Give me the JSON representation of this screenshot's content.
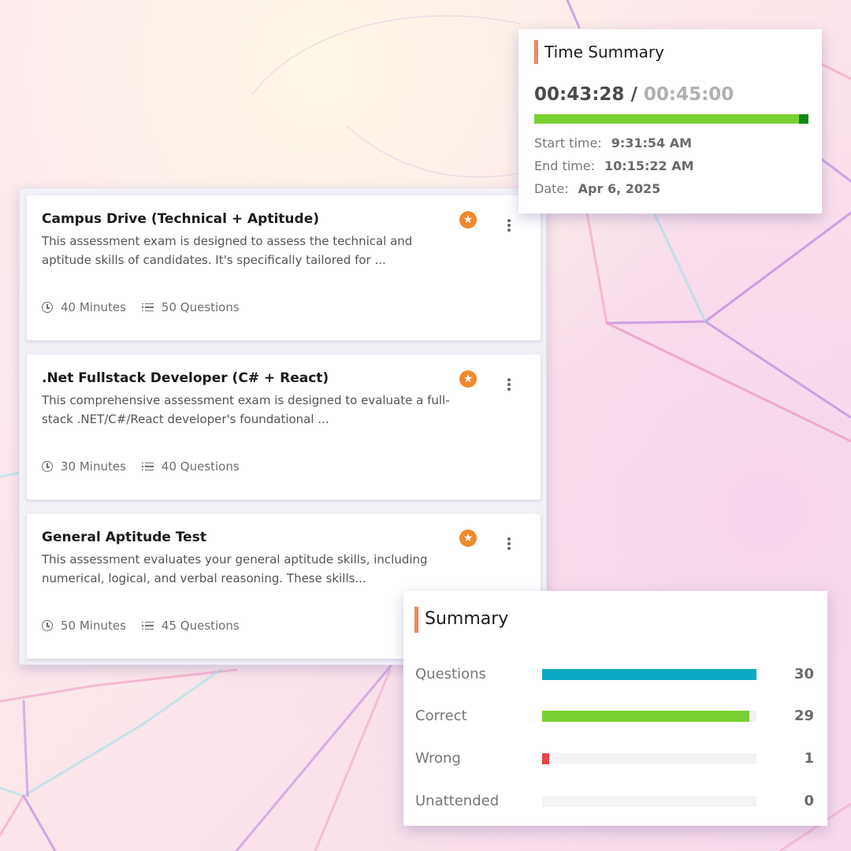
{
  "colors": {
    "accent": "#f0855d",
    "star": "#f0882d",
    "progress_fill": "#77d132",
    "progress_end": "#0e8a16",
    "questions_bar": "#0aa8c2",
    "correct_bar": "#77d132",
    "wrong_bar": "#e8434a",
    "track": "#f4f4f6"
  },
  "exams": [
    {
      "title": "Campus Drive (Technical + Aptitude)",
      "desc_line1": "This assessment exam is designed to assess the technical and",
      "desc_line2": "aptitude skills of candidates. It's specifically tailored for ...",
      "duration": "40 Minutes",
      "questions": "50 Questions",
      "star_icon": "star-icon",
      "menu_icon": "more-vertical-icon"
    },
    {
      "title": ".Net Fullstack Developer (C# + React)",
      "desc_line1": "This comprehensive assessment exam is designed to evaluate a full-",
      "desc_line2": "stack .NET/C#/React developer's foundational ...",
      "duration": "30 Minutes",
      "questions": "40 Questions",
      "star_icon": "star-icon",
      "menu_icon": "more-vertical-icon"
    },
    {
      "title": "General Aptitude Test",
      "desc_line1": "This assessment evaluates your general aptitude skills, including",
      "desc_line2": "numerical, logical, and verbal reasoning. These skills...",
      "duration": "50 Minutes",
      "questions": "45 Questions",
      "star_icon": "star-icon",
      "menu_icon": "more-vertical-icon"
    }
  ],
  "time_summary": {
    "title": "Time Summary",
    "elapsed": "00:43:28",
    "separator": "/",
    "total": "00:45:00",
    "progress_fraction": 0.966,
    "start_label": "Start time:",
    "start_value": "9:31:54 AM",
    "end_label": "End time:",
    "end_value": "10:15:22 AM",
    "date_label": "Date:",
    "date_value": "Apr 6, 2025"
  },
  "summary": {
    "title": "Summary",
    "total": 30,
    "rows": [
      {
        "label": "Questions",
        "count": "30",
        "value": 30,
        "color": "#0aa8c2"
      },
      {
        "label": "Correct",
        "count": "29",
        "value": 29,
        "color": "#77d132"
      },
      {
        "label": "Wrong",
        "count": "1",
        "value": 1,
        "color": "#e8434a"
      },
      {
        "label": "Unattended",
        "count": "0",
        "value": 0,
        "color": "#0aa8c2"
      }
    ]
  }
}
